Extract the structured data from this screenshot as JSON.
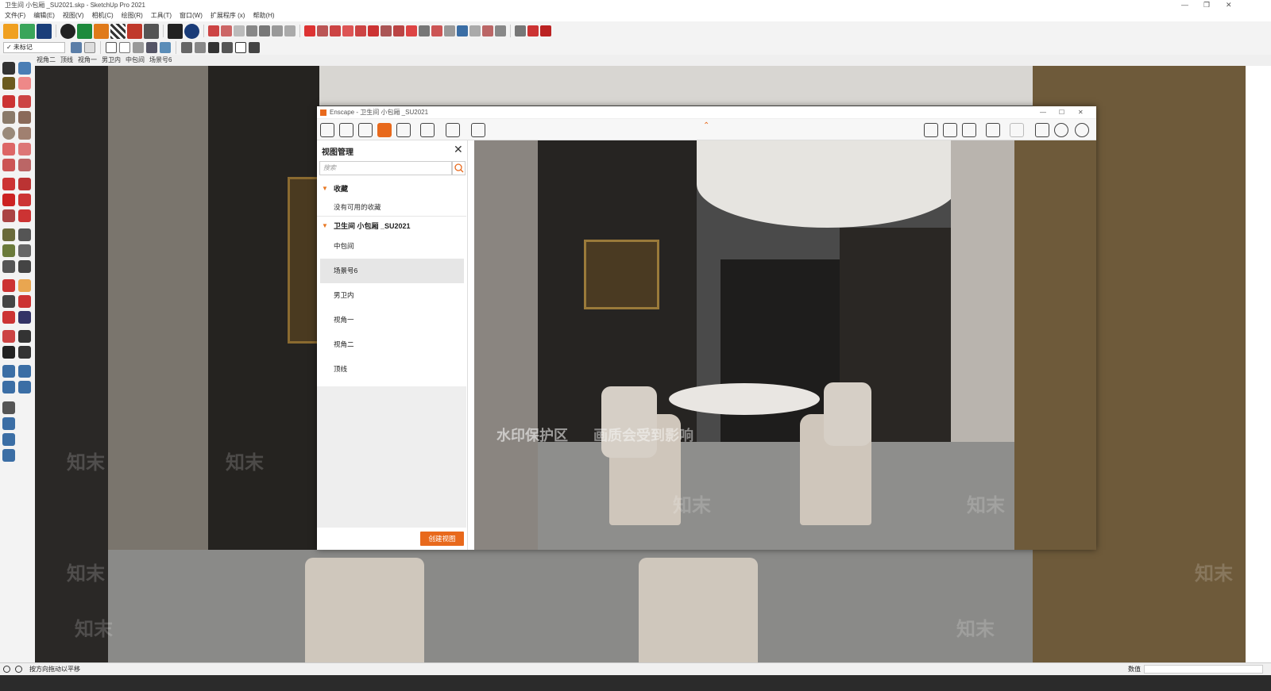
{
  "window": {
    "title": "卫生间 小包厢 _SU2021.skp - SketchUp Pro 2021",
    "controls": [
      "—",
      "❐",
      "✕"
    ]
  },
  "menu": [
    "文件(F)",
    "编辑(E)",
    "视图(V)",
    "相机(C)",
    "绘图(R)",
    "工具(T)",
    "窗口(W)",
    "扩展程序 (x)",
    "帮助(H)"
  ],
  "layer_select": {
    "value": "✓ 未标记"
  },
  "scene_tabs": [
    "视角二",
    "顶线",
    "视角一",
    "男卫内",
    "中包间",
    "场景号6"
  ],
  "statusbar": {
    "hint": "按方向拖动以平移",
    "measure_label": "数值"
  },
  "enscape": {
    "title": "Enscape - 卫生间 小包厢 _SU2021",
    "panel_title": "视图管理",
    "search_placeholder": "搜索",
    "favorites": {
      "label": "收藏",
      "empty": "没有可用的收藏"
    },
    "model": {
      "label": "卫生间 小包厢 _SU2021",
      "views": [
        "中包间",
        "场景号6",
        "男卫内",
        "视角一",
        "视角二",
        "顶线"
      ],
      "selected_index": 1
    },
    "create_button": "创建视图",
    "controls": [
      "—",
      "☐",
      "✕"
    ]
  },
  "watermark": {
    "zone_text": "水印保护区",
    "quality_text": "画质会受到影响",
    "brand": "知末"
  },
  "colors": {
    "accent": "#e8691c",
    "selected_row": "#e6e6e6"
  }
}
